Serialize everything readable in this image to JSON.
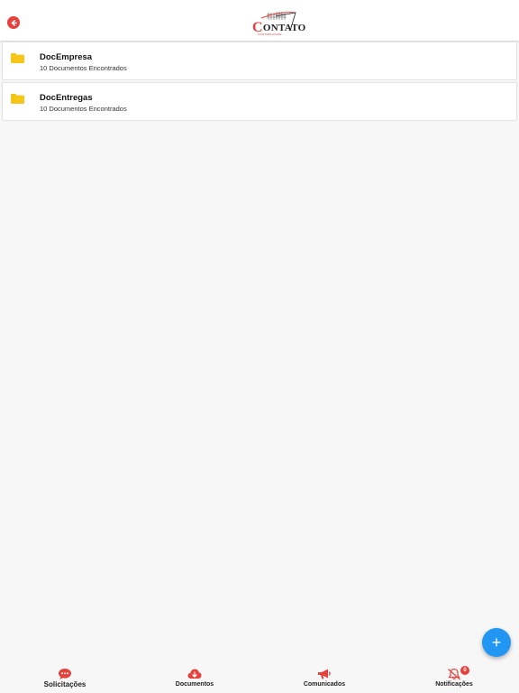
{
  "header": {
    "back_icon": "arrow-left-circle-icon",
    "logo_main": "CONTATO",
    "logo_initial": "C",
    "logo_rest": "ONTATO",
    "logo_sub": "CONTABILIDADE"
  },
  "folders": [
    {
      "icon": "folder-icon",
      "title": "DocEmpresa",
      "subtitle": "10 Documentos Encontrados"
    },
    {
      "icon": "folder-icon",
      "title": "DocEntregas",
      "subtitle": "10 Documentos Encontrados"
    }
  ],
  "fab": {
    "label": "+",
    "icon": "plus-icon"
  },
  "tabbar": {
    "tabs": [
      {
        "label": "Solicitações",
        "icon": "chat-bubble-icon",
        "active": true
      },
      {
        "label": "Documentos",
        "icon": "cloud-download-icon",
        "active": false
      },
      {
        "label": "Comunicados",
        "icon": "megaphone-icon",
        "active": false
      },
      {
        "label": "Notificações",
        "icon": "bell-off-icon",
        "active": false,
        "badge": "0"
      }
    ]
  },
  "colors": {
    "accent_red": "#e8413c",
    "folder_yellow": "#f5c518",
    "fab_blue": "#2196f3",
    "background": "#f7f7f7"
  }
}
